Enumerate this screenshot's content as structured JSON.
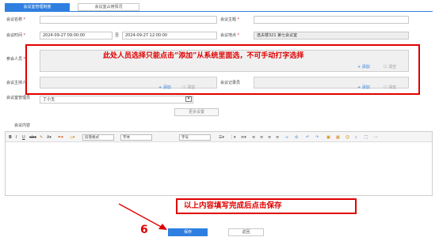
{
  "tabs": [
    {
      "label": "会议室管理制度",
      "active": true
    },
    {
      "label": "会议室占用情况",
      "active": false
    }
  ],
  "form": {
    "name_label": "会议名称",
    "subject_label": "会议主题",
    "time_label": "会议时间",
    "start_time": "2024-09-27 09:00:00",
    "time_sep": "至",
    "end_time": "2024-09-27 12:00:00",
    "location_label": "会议地点",
    "location_value": "逸夫楼321 第七会议室",
    "attendees_label": "参会人员",
    "host_label": "会议主持人",
    "recorder_label": "会议记录员",
    "manager_label": "会议室管理员",
    "manager_value": "丁小玉",
    "required_mark": "*",
    "add_label": "+ 添加",
    "clear_label": "☐ 清空",
    "more_label": "更多设置",
    "content_label": "会议内容"
  },
  "editor_toolbar": {
    "paragraph_format": "段落格式",
    "font_family": "字体",
    "font_size": "字号"
  },
  "annotations": {
    "top_note": "此处人员选择只能点击“添加”从系统里面选，不可手动打字选择",
    "bottom_note": "以上内容填写完成后点击保存",
    "step_number": "6"
  },
  "buttons": {
    "save": "保存",
    "back": "返回"
  },
  "colors": {
    "accent": "#2f7fe0",
    "annotation_red": "#e00000"
  },
  "icons": [
    "bold-icon",
    "italic-icon",
    "underline-icon",
    "strikethrough-icon",
    "format-painter-icon",
    "font-color-icon",
    "highlight-icon",
    "eraser-icon",
    "line-height-icon",
    "ordered-list-icon",
    "unordered-list-icon",
    "align-left-icon",
    "align-center-icon",
    "align-right-icon",
    "justify-icon",
    "link-icon",
    "unlink-icon",
    "undo-icon",
    "redo-icon",
    "image-icon",
    "table-icon",
    "emoji-icon",
    "fullscreen-icon",
    "preview-icon",
    "code-icon",
    "dropdown-arrow-icon"
  ]
}
